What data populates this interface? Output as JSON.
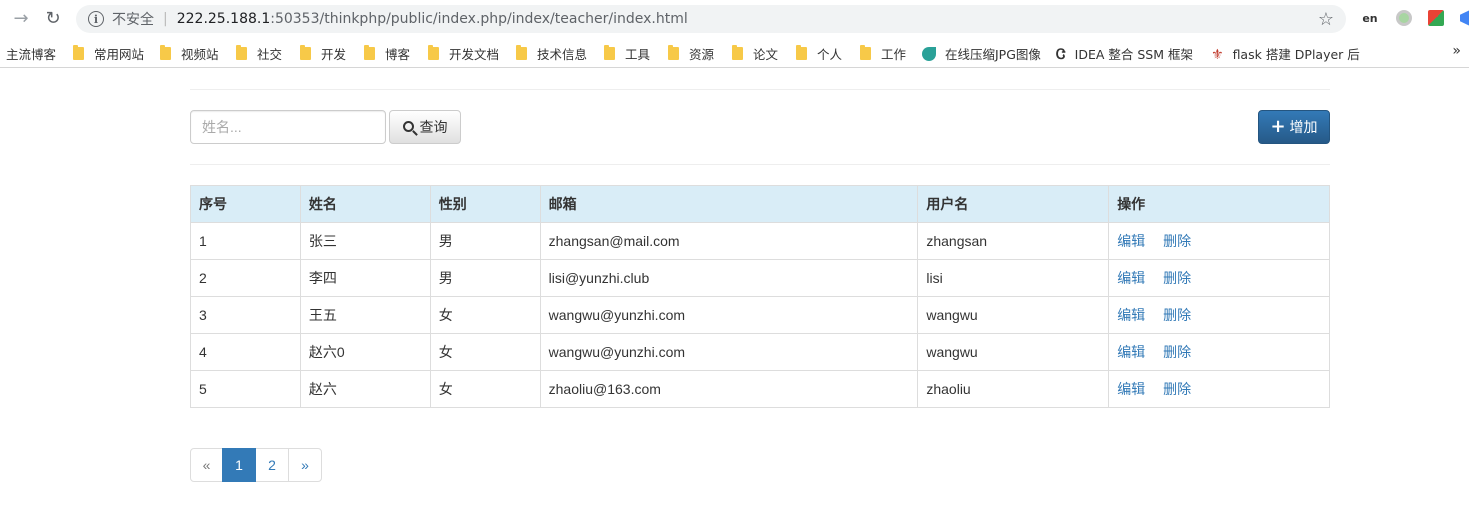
{
  "browser": {
    "insecure_label": "不安全",
    "separator": "|",
    "url_host": "222.25.188.1",
    "url_rest": ":50353/thinkphp/public/index.php/index/teacher/index.html",
    "bookmarks": [
      {
        "label": "主流博客",
        "icon": "none"
      },
      {
        "label": "常用网站",
        "icon": "folder-icon"
      },
      {
        "label": "视频站",
        "icon": "folder-icon"
      },
      {
        "label": "社交",
        "icon": "folder-icon"
      },
      {
        "label": "开发",
        "icon": "folder-icon"
      },
      {
        "label": "博客",
        "icon": "folder-icon"
      },
      {
        "label": "开发文档",
        "icon": "folder-icon"
      },
      {
        "label": "技术信息",
        "icon": "folder-icon"
      },
      {
        "label": "工具",
        "icon": "folder-icon"
      },
      {
        "label": "资源",
        "icon": "folder-icon"
      },
      {
        "label": "论文",
        "icon": "folder-icon"
      },
      {
        "label": "个人",
        "icon": "folder-icon"
      },
      {
        "label": "工作",
        "icon": "folder-icon"
      },
      {
        "label": "在线压缩JPG图像",
        "icon": "leaf-icon"
      },
      {
        "label": "IDEA 整合 SSM 框架",
        "icon": "idea-icon"
      },
      {
        "label": "flask 搭建 DPlayer 后",
        "icon": "flask-icon"
      }
    ],
    "more_label": "»"
  },
  "toolbar": {
    "search_placeholder": "姓名...",
    "query_label": "查询",
    "add_label": "增加"
  },
  "table": {
    "headers": [
      "序号",
      "姓名",
      "性别",
      "邮箱",
      "用户名",
      "操作"
    ],
    "rows": [
      {
        "id": "1",
        "name": "张三",
        "gender": "男",
        "email": "zhangsan@mail.com",
        "username": "zhangsan"
      },
      {
        "id": "2",
        "name": "李四",
        "gender": "男",
        "email": "lisi@yunzhi.club",
        "username": "lisi"
      },
      {
        "id": "3",
        "name": "王五",
        "gender": "女",
        "email": "wangwu@yunzhi.com",
        "username": "wangwu"
      },
      {
        "id": "4",
        "name": "赵六0",
        "gender": "女",
        "email": "wangwu@yunzhi.com",
        "username": "wangwu"
      },
      {
        "id": "5",
        "name": "赵六",
        "gender": "女",
        "email": "zhaoliu@163.com",
        "username": "zhaoliu"
      }
    ],
    "edit_label": "编辑",
    "delete_label": "删除"
  },
  "pagination": {
    "prev": "«",
    "pages": [
      "1",
      "2"
    ],
    "active": "1",
    "next": "»"
  },
  "colors": {
    "primary": "#337ab7",
    "table_header_bg": "#d9edf7"
  }
}
